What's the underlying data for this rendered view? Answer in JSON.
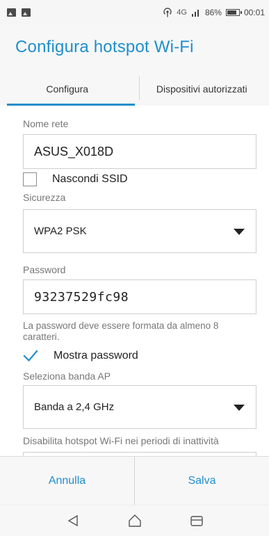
{
  "status_bar": {
    "icons": [
      "gallery-icon",
      "gallery-icon",
      "hotspot-icon",
      "signal-icon",
      "battery-icon"
    ],
    "network": "4G",
    "battery": "86%",
    "time": "00:01"
  },
  "header": {
    "title": "Configura hotspot Wi-Fi"
  },
  "tabs": [
    {
      "label": "Configura",
      "active": true
    },
    {
      "label": "Dispositivi autorizzati",
      "active": false
    }
  ],
  "form": {
    "network_name": {
      "label": "Nome rete",
      "value": "ASUS_X018D"
    },
    "hide_ssid": {
      "label": "Nascondi SSID",
      "checked": false
    },
    "security": {
      "label": "Sicurezza",
      "value": "WPA2 PSK"
    },
    "password": {
      "label": "Password",
      "value": "93237529fc98",
      "hint": "La password deve essere formata da almeno 8 caratteri."
    },
    "show_password": {
      "label": "Mostra password",
      "checked": true
    },
    "ap_band": {
      "label": "Seleziona banda AP",
      "value": "Banda a 2,4 GHz"
    },
    "disable_idle": {
      "label": "Disabilita hotspot Wi-Fi nei periodi di inattività"
    }
  },
  "buttons": {
    "cancel": "Annulla",
    "save": "Salva"
  },
  "colors": {
    "accent": "#1f8ecb",
    "check": "#1f8ecb"
  }
}
